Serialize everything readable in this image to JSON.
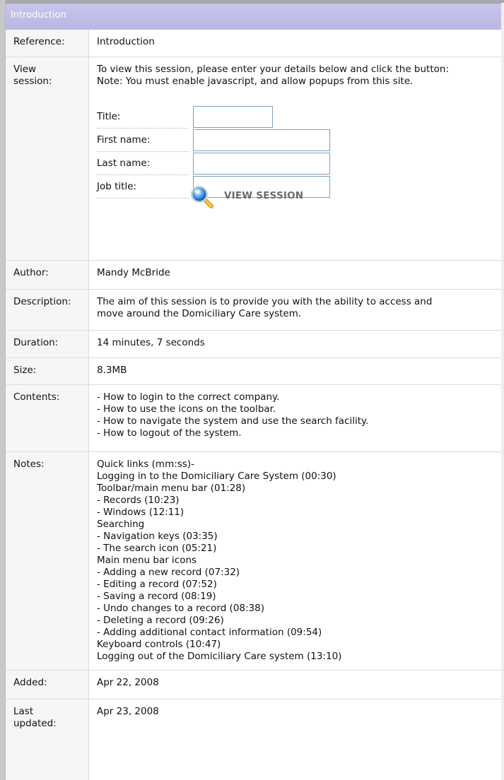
{
  "session": {
    "header_title": "Introduction",
    "reference": {
      "label": "Reference:",
      "value": "Introduction"
    },
    "view_session": {
      "label_line1": "View",
      "label_line2": "session:",
      "instruction_line1": "To view this session, please enter your details below and click the button:",
      "instruction_line2": "Note: You must enable javascript, and allow popups from this site.",
      "fields": {
        "title_label": "Title:",
        "title_value": "",
        "first_name_label": "First name:",
        "first_name_value": "",
        "last_name_label": "Last name:",
        "last_name_value": "",
        "job_title_label": "Job title:",
        "job_title_value": ""
      },
      "button_label": "VIEW SESSION",
      "button_icon": "magnifier-icon"
    },
    "author": {
      "label": "Author:",
      "value": "Mandy McBride"
    },
    "description": {
      "label": "Description:",
      "line1": "The aim of this session is to provide you with the ability to access and",
      "line2": "move around the Domiciliary Care system."
    },
    "duration": {
      "label": "Duration:",
      "value": "14 minutes, 7 seconds"
    },
    "size": {
      "label": "Size:",
      "value": "8.3MB"
    },
    "contents": {
      "label": "Contents:",
      "items": [
        "- How to login to the correct company.",
        "- How to use the icons on the toolbar.",
        "- How to navigate the system and use the search facility.",
        "- How to logout of the system."
      ]
    },
    "notes": {
      "label": "Notes:",
      "lines": [
        "Quick links (mm:ss)-",
        "Logging in to the Domiciliary Care System (00:30)",
        "Toolbar/main menu bar (01:28)",
        "- Records (10:23)",
        "- Windows (12:11)",
        "Searching",
        "- Navigation keys (03:35)",
        "- The search icon (05:21)",
        "Main menu bar icons",
        "- Adding a new record (07:32)",
        "- Editing a record (07:52)",
        "- Saving a record (08:19)",
        "- Undo changes to a record (08:38)",
        "- Deleting a record (09:26)",
        "- Adding additional contact information (09:54)",
        "Keyboard controls (10:47)",
        "Logging out of the Domiciliary Care system (13:10)"
      ]
    },
    "added": {
      "label": "Added:",
      "value": "Apr 22, 2008"
    },
    "last_updated": {
      "label_line1": "Last",
      "label_line2": "updated:",
      "value": "Apr 23, 2008"
    },
    "colors": {
      "header_bg": "#bcbae6",
      "label_bg": "#f6f6f6",
      "border": "#dcdcdc",
      "input_border": "#7f9db9"
    }
  }
}
